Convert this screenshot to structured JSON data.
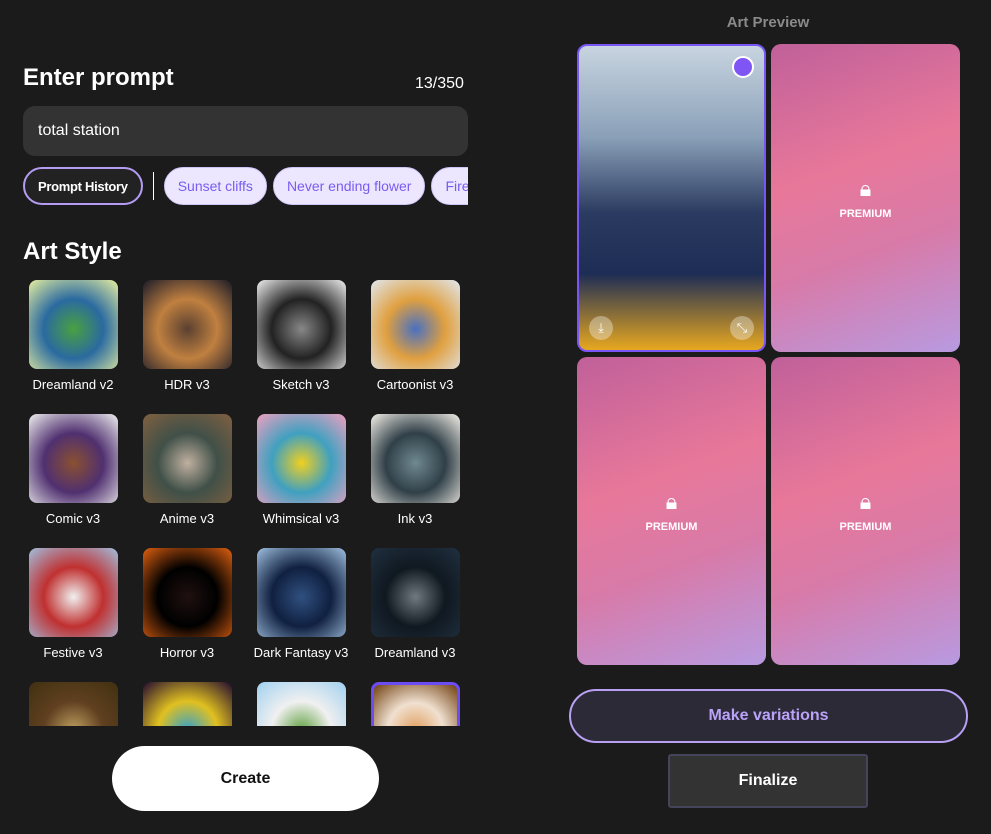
{
  "prompt": {
    "title": "Enter prompt",
    "counter": "13/350",
    "value": "total station",
    "history_label": "Prompt History",
    "suggestions": [
      "Sunset cliffs",
      "Never ending flower",
      "Fire and water"
    ]
  },
  "art_style": {
    "title": "Art Style",
    "styles": [
      {
        "label": "Dreamland v2",
        "colors": [
          "#e8f0a0",
          "#4aa040",
          "#2a6aa0"
        ]
      },
      {
        "label": "HDR v3",
        "colors": [
          "#1a1a28",
          "#5a4030",
          "#c08040"
        ]
      },
      {
        "label": "Sketch v3",
        "colors": [
          "#f0f0f0",
          "#888",
          "#222"
        ]
      },
      {
        "label": "Cartoonist v3",
        "colors": [
          "#e0e8f0",
          "#4a70c0",
          "#e0a040"
        ]
      },
      {
        "label": "Comic v3",
        "colors": [
          "#f0f0f0",
          "#8a5030",
          "#503070"
        ]
      },
      {
        "label": "Anime v3",
        "colors": [
          "#806040",
          "#c0b0a0",
          "#405048"
        ]
      },
      {
        "label": "Whimsical v3",
        "colors": [
          "#f0a0c0",
          "#f0d020",
          "#40a0c0"
        ]
      },
      {
        "label": "Ink v3",
        "colors": [
          "#f5f0e8",
          "#708890",
          "#304048"
        ]
      },
      {
        "label": "Festive v3",
        "colors": [
          "#a0c0e0",
          "#f0f0f0",
          "#c03030"
        ]
      },
      {
        "label": "Horror v3",
        "colors": [
          "#e06010",
          "#201010",
          "#000"
        ]
      },
      {
        "label": "Dark Fantasy v3",
        "colors": [
          "#a0c0e0",
          "#305080",
          "#102040"
        ]
      },
      {
        "label": "Dreamland v3",
        "colors": [
          "#203040",
          "#707880",
          "#101820"
        ]
      },
      {
        "label": "",
        "colors": [
          "#403010",
          "#c0a060",
          "#604020"
        ]
      },
      {
        "label": "",
        "colors": [
          "#200830",
          "#30a0d0",
          "#e0c020"
        ]
      },
      {
        "label": "",
        "colors": [
          "#a0d0f0",
          "#60a040",
          "#f0f0f0"
        ]
      },
      {
        "label": "",
        "colors": [
          "#704010",
          "#e0a060",
          "#f0e0d0"
        ]
      }
    ],
    "selected_index": 15
  },
  "create_label": "Create",
  "preview": {
    "title": "Art Preview",
    "locked_label": "PREMIUM",
    "accent": "#7a55f5"
  },
  "make_variations_label": "Make variations",
  "finalize_label": "Finalize"
}
